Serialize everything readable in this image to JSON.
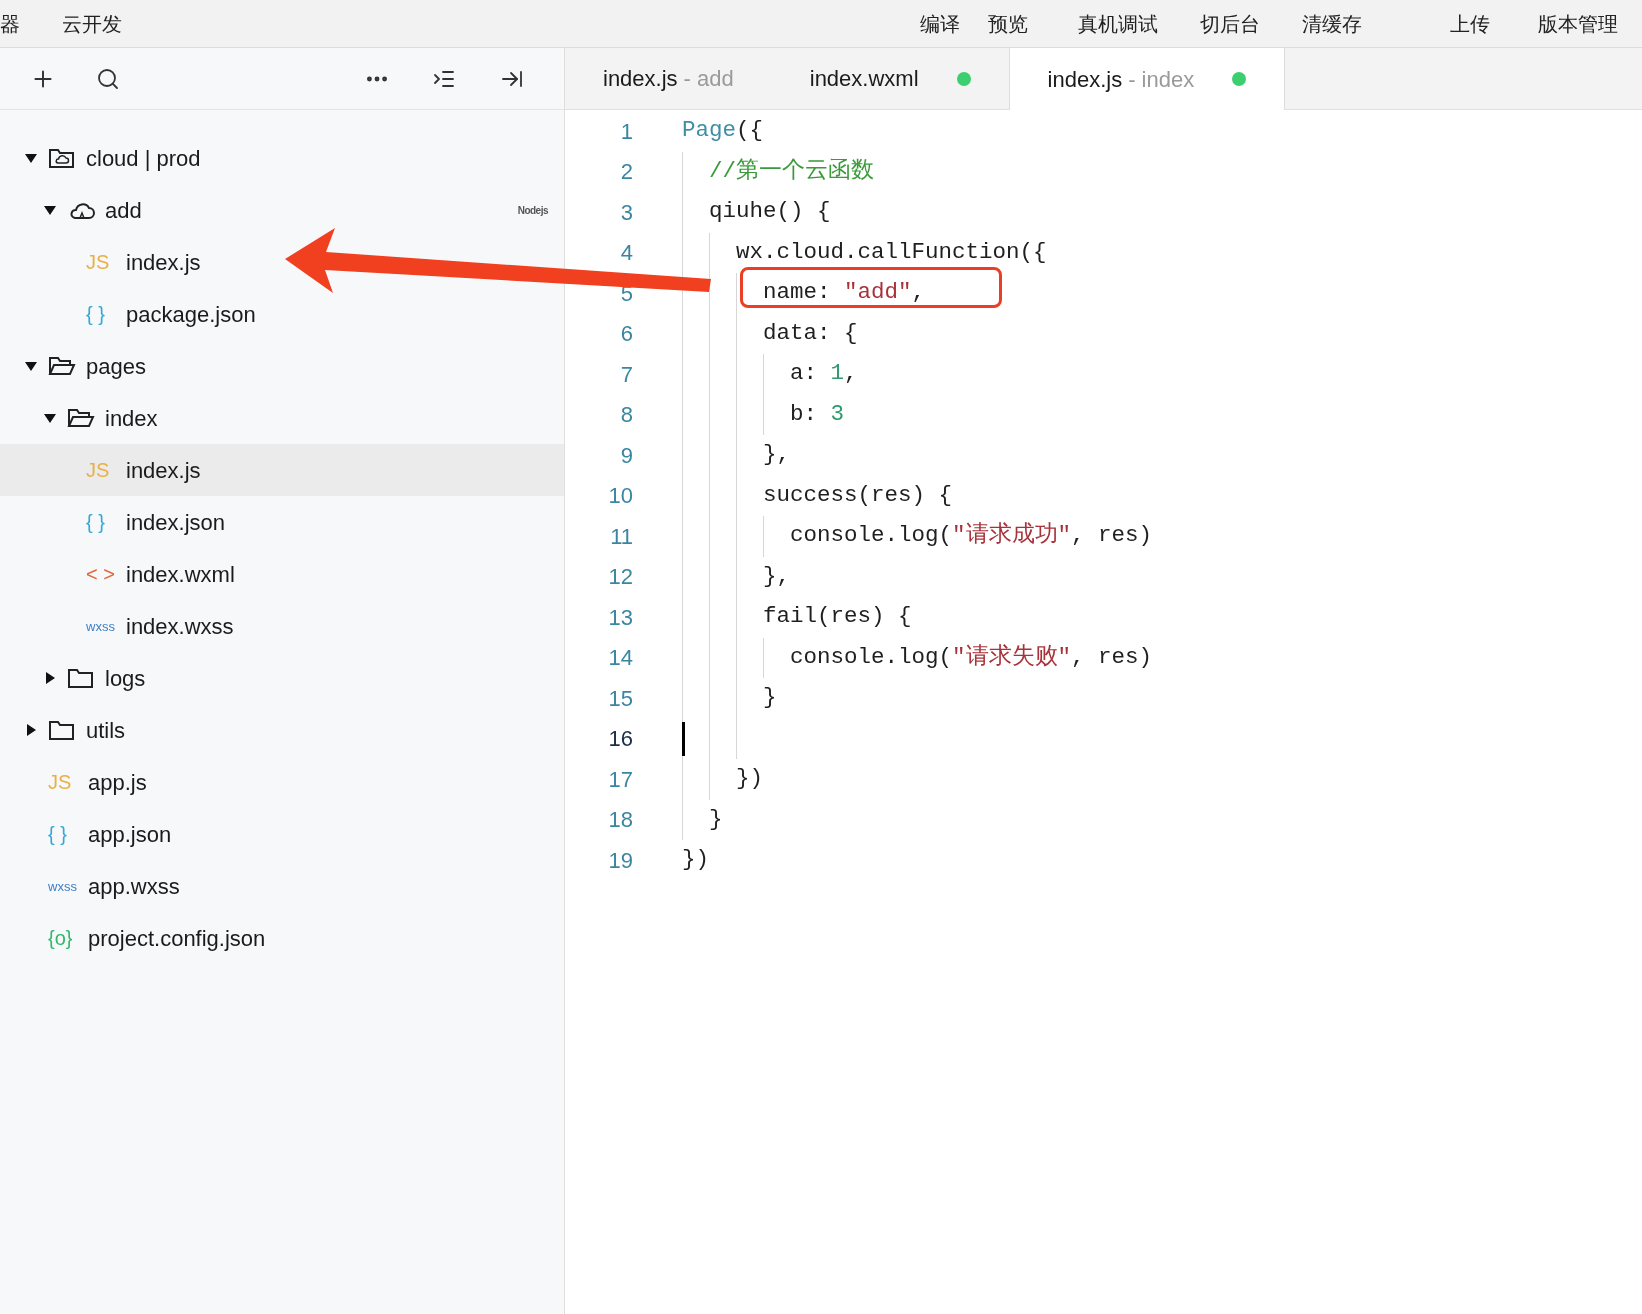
{
  "menu_bar": {
    "left": [
      "器",
      "云开发"
    ],
    "right": [
      "编译",
      "预览",
      "真机调试",
      "切后台",
      "清缓存",
      "上传",
      "版本管理"
    ]
  },
  "tabs": [
    {
      "label": "index.js",
      "suffix": "- add",
      "modified": false,
      "selected": false
    },
    {
      "label": "index.wxml",
      "modified": true,
      "selected": false
    },
    {
      "label": "index.js",
      "suffix": "- index",
      "modified": true,
      "selected": true
    }
  ],
  "file_tree": [
    {
      "name": "cloud | prod",
      "kind": "cloud_root",
      "expanded": true,
      "selected": false,
      "children": [
        {
          "name": "add",
          "kind": "cloud_function",
          "expanded": true,
          "selected": false,
          "badge": "Nodejs",
          "children": [
            {
              "name": "index.js",
              "kind": "file",
              "color": "#e8b04a",
              "icon_text": "JS",
              "selected": false
            },
            {
              "name": "package.json",
              "kind": "file",
              "color": "#35a8d8",
              "icon_text": "{ }",
              "selected": false
            }
          ]
        }
      ]
    },
    {
      "name": "pages",
      "kind": "folder",
      "expanded": true,
      "selected": false,
      "children": [
        {
          "name": "index",
          "kind": "folder",
          "expanded": true,
          "selected": false,
          "children": [
            {
              "name": "index.js",
              "kind": "file",
              "color": "#e8b04a",
              "icon_text": "JS",
              "selected": true
            },
            {
              "name": "index.json",
              "kind": "file",
              "color": "#35a8d8",
              "icon_text": "{ }",
              "selected": false
            },
            {
              "name": "index.wxml",
              "kind": "file",
              "color": "#e2663a",
              "icon_text": "< >",
              "selected": false
            },
            {
              "name": "index.wxss",
              "kind": "file",
              "color": "#3f7ec4",
              "icon_text": "wxss",
              "selected": false
            }
          ]
        },
        {
          "name": "logs",
          "kind": "folder",
          "expanded": false,
          "selected": false
        }
      ]
    },
    {
      "name": "utils",
      "kind": "folder",
      "expanded": false,
      "selected": false
    },
    {
      "name": "app.js",
      "kind": "file",
      "color": "#e8b04a",
      "icon_text": "JS",
      "selected": false
    },
    {
      "name": "app.json",
      "kind": "file",
      "color": "#35a8d8",
      "icon_text": "{ }",
      "selected": false
    },
    {
      "name": "app.wxss",
      "kind": "file",
      "color": "#3f7ec4",
      "icon_text": "wxss",
      "selected": false
    },
    {
      "name": "project.config.json",
      "kind": "file",
      "color": "#32b86a",
      "icon_text": "{o}",
      "selected": false
    }
  ],
  "editor": {
    "lines": [
      {
        "number": "1",
        "cursor": false,
        "highlighted": false,
        "tokens": [
          {
            "kind": "keyword",
            "text": "Page"
          },
          {
            "kind": "plain",
            "text": "({"
          }
        ]
      },
      {
        "number": "2",
        "cursor": false,
        "highlighted": false,
        "tokens": [
          {
            "kind": "comment",
            "text": "  //第一个云函数"
          }
        ]
      },
      {
        "number": "3",
        "cursor": false,
        "highlighted": false,
        "tokens": [
          {
            "kind": "plain",
            "text": "  qiuhe() {"
          }
        ]
      },
      {
        "number": "4",
        "cursor": false,
        "highlighted": false,
        "tokens": [
          {
            "kind": "plain",
            "text": "    wx.cloud.callFunction({"
          }
        ]
      },
      {
        "number": "5",
        "cursor": false,
        "highlighted": true,
        "tokens": [
          {
            "kind": "plain",
            "text": "      name: "
          },
          {
            "kind": "string",
            "text": "\"add\""
          },
          {
            "kind": "plain",
            "text": ","
          }
        ]
      },
      {
        "number": "6",
        "cursor": false,
        "highlighted": false,
        "tokens": [
          {
            "kind": "plain",
            "text": "      data: {"
          }
        ]
      },
      {
        "number": "7",
        "cursor": false,
        "highlighted": false,
        "tokens": [
          {
            "kind": "plain",
            "text": "        a: "
          },
          {
            "kind": "number",
            "text": "1"
          },
          {
            "kind": "plain",
            "text": ","
          }
        ]
      },
      {
        "number": "8",
        "cursor": false,
        "highlighted": false,
        "tokens": [
          {
            "kind": "plain",
            "text": "        b: "
          },
          {
            "kind": "number",
            "text": "3"
          }
        ]
      },
      {
        "number": "9",
        "cursor": false,
        "highlighted": false,
        "tokens": [
          {
            "kind": "plain",
            "text": "      },"
          }
        ]
      },
      {
        "number": "10",
        "cursor": false,
        "highlighted": false,
        "tokens": [
          {
            "kind": "plain",
            "text": "      success(res) {"
          }
        ]
      },
      {
        "number": "11",
        "cursor": false,
        "highlighted": false,
        "tokens": [
          {
            "kind": "plain",
            "text": "        console.log("
          },
          {
            "kind": "string",
            "text": "\"请求成功\""
          },
          {
            "kind": "plain",
            "text": ", res)"
          }
        ]
      },
      {
        "number": "12",
        "cursor": false,
        "highlighted": false,
        "tokens": [
          {
            "kind": "plain",
            "text": "      },"
          }
        ]
      },
      {
        "number": "13",
        "cursor": false,
        "highlighted": false,
        "tokens": [
          {
            "kind": "plain",
            "text": "      fail(res) {"
          }
        ]
      },
      {
        "number": "14",
        "cursor": false,
        "highlighted": false,
        "tokens": [
          {
            "kind": "plain",
            "text": "        console.log("
          },
          {
            "kind": "string",
            "text": "\"请求失败\""
          },
          {
            "kind": "plain",
            "text": ", res)"
          }
        ]
      },
      {
        "number": "15",
        "cursor": false,
        "highlighted": false,
        "tokens": [
          {
            "kind": "plain",
            "text": "      }"
          }
        ]
      },
      {
        "number": "16",
        "cursor": true,
        "highlighted": false
      },
      {
        "number": "17",
        "cursor": false,
        "highlighted": false,
        "tokens": [
          {
            "kind": "plain",
            "text": "    })"
          }
        ]
      },
      {
        "number": "18",
        "cursor": false,
        "highlighted": false,
        "tokens": [
          {
            "kind": "plain",
            "text": "  }"
          }
        ]
      },
      {
        "number": "19",
        "cursor": false,
        "highlighted": false,
        "tokens": [
          {
            "kind": "plain",
            "text": "})"
          }
        ]
      }
    ]
  }
}
